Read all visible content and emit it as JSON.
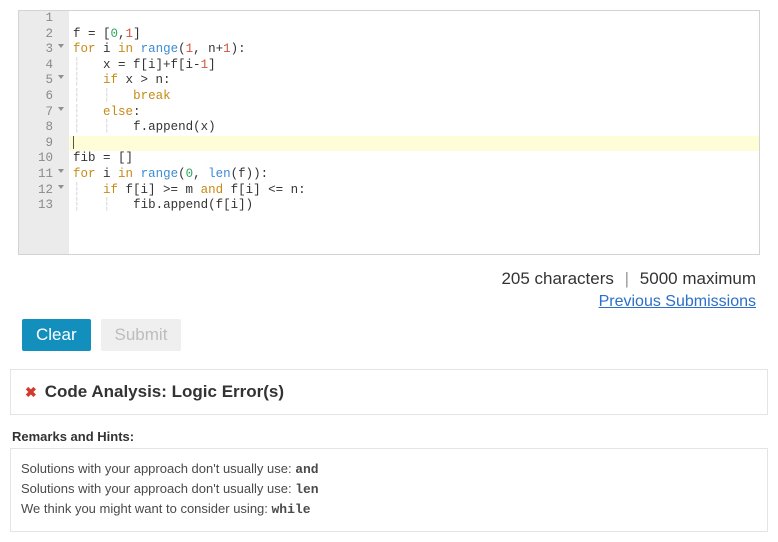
{
  "editor": {
    "highlight_line": 9,
    "lines": [
      {
        "n": 1,
        "fold": false,
        "tokens": []
      },
      {
        "n": 2,
        "fold": false,
        "tokens": [
          {
            "t": "f = [",
            "c": "tok-ident"
          },
          {
            "t": "0",
            "c": "tok-num0"
          },
          {
            "t": ",",
            "c": "tok-punc"
          },
          {
            "t": "1",
            "c": "tok-num1"
          },
          {
            "t": "]",
            "c": "tok-punc"
          }
        ]
      },
      {
        "n": 3,
        "fold": true,
        "tokens": [
          {
            "t": "for",
            "c": "tok-kw"
          },
          {
            "t": " i ",
            "c": "tok-ident"
          },
          {
            "t": "in",
            "c": "tok-kw"
          },
          {
            "t": " ",
            "c": ""
          },
          {
            "t": "range",
            "c": "tok-builtin"
          },
          {
            "t": "(",
            "c": "tok-punc"
          },
          {
            "t": "1",
            "c": "tok-num1"
          },
          {
            "t": ", n+",
            "c": "tok-ident"
          },
          {
            "t": "1",
            "c": "tok-num1"
          },
          {
            "t": "):",
            "c": "tok-punc"
          }
        ]
      },
      {
        "n": 4,
        "fold": false,
        "tokens": [
          {
            "t": "    ",
            "c": "indent-guide",
            "guide": true
          },
          {
            "t": "x = f[i]+f[i-",
            "c": "tok-ident"
          },
          {
            "t": "1",
            "c": "tok-num1"
          },
          {
            "t": "]",
            "c": "tok-punc"
          }
        ]
      },
      {
        "n": 5,
        "fold": true,
        "tokens": [
          {
            "t": "    ",
            "c": "indent-guide",
            "guide": true
          },
          {
            "t": "if",
            "c": "tok-kw"
          },
          {
            "t": " x > n:",
            "c": "tok-ident"
          }
        ]
      },
      {
        "n": 6,
        "fold": false,
        "tokens": [
          {
            "t": "        ",
            "c": "indent-guide",
            "guide": true
          },
          {
            "t": "break",
            "c": "tok-kw"
          }
        ]
      },
      {
        "n": 7,
        "fold": true,
        "tokens": [
          {
            "t": "    ",
            "c": "indent-guide",
            "guide": true
          },
          {
            "t": "else",
            "c": "tok-kw"
          },
          {
            "t": ":",
            "c": "tok-punc"
          }
        ]
      },
      {
        "n": 8,
        "fold": false,
        "tokens": [
          {
            "t": "        ",
            "c": "indent-guide",
            "guide": true
          },
          {
            "t": "f.append(x)",
            "c": "tok-ident"
          }
        ]
      },
      {
        "n": 9,
        "fold": false,
        "tokens": [
          {
            "t": "",
            "c": "",
            "cursor": true
          }
        ]
      },
      {
        "n": 10,
        "fold": false,
        "tokens": [
          {
            "t": "fib = []",
            "c": "tok-ident"
          }
        ]
      },
      {
        "n": 11,
        "fold": true,
        "tokens": [
          {
            "t": "for",
            "c": "tok-kw"
          },
          {
            "t": " i ",
            "c": "tok-ident"
          },
          {
            "t": "in",
            "c": "tok-kw"
          },
          {
            "t": " ",
            "c": ""
          },
          {
            "t": "range",
            "c": "tok-builtin"
          },
          {
            "t": "(",
            "c": "tok-punc"
          },
          {
            "t": "0",
            "c": "tok-num0"
          },
          {
            "t": ", ",
            "c": "tok-punc"
          },
          {
            "t": "len",
            "c": "tok-builtin"
          },
          {
            "t": "(f)):",
            "c": "tok-punc"
          }
        ]
      },
      {
        "n": 12,
        "fold": true,
        "tokens": [
          {
            "t": "    ",
            "c": "indent-guide",
            "guide": true
          },
          {
            "t": "if",
            "c": "tok-kw"
          },
          {
            "t": " f[i] >= m ",
            "c": "tok-ident"
          },
          {
            "t": "and",
            "c": "tok-kw"
          },
          {
            "t": " f[i] <= n:",
            "c": "tok-ident"
          }
        ]
      },
      {
        "n": 13,
        "fold": false,
        "tokens": [
          {
            "t": "        ",
            "c": "indent-guide",
            "guide": true
          },
          {
            "t": "fib.append(f[i])",
            "c": "tok-ident"
          }
        ]
      }
    ]
  },
  "status": {
    "chars": "205 characters",
    "sep": "|",
    "max": "5000 maximum",
    "prev_link": "Previous Submissions"
  },
  "buttons": {
    "clear": "Clear",
    "submit": "Submit"
  },
  "analysis": {
    "title": "Code Analysis: Logic Error(s)"
  },
  "remarks": {
    "label": "Remarks and Hints:",
    "items": [
      {
        "text": "Solutions with your approach don't usually use: ",
        "code": "and"
      },
      {
        "text": "Solutions with your approach don't usually use: ",
        "code": "len"
      },
      {
        "text": "We think you might want to consider using: ",
        "code": "while"
      }
    ]
  }
}
